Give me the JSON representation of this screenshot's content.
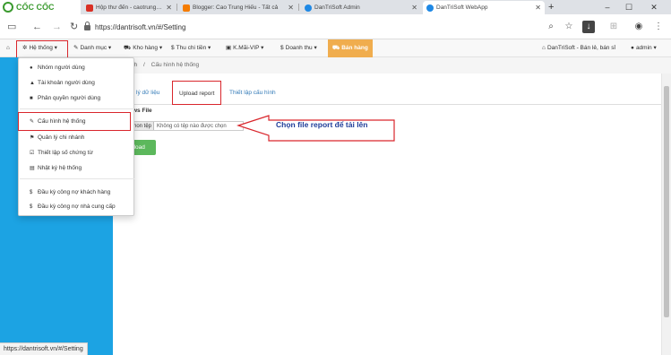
{
  "browser": {
    "logo_text": "CỐC CỐC",
    "tabs": [
      {
        "title": "Hộp thư đến - caotrunghieu.com",
        "favicon_color": "#d93025"
      },
      {
        "title": "Blogger: Cao Trung Hiếu - Tất cả",
        "favicon_color": "#f57c00"
      },
      {
        "title": "DanTriSoft Admin",
        "favicon_color": "#1e88e5"
      },
      {
        "title": "DanTriSoft WebApp",
        "favicon_color": "#1e88e5"
      }
    ],
    "active_tab": 3,
    "new_tab_label": "+",
    "url": "https://dantrisoft.vn/#/Setting",
    "status_url": "https://dantrisoft.vn/#/Setting"
  },
  "navbar": {
    "items": [
      {
        "label": "Hệ thống",
        "icon": "gear-icon"
      },
      {
        "label": "Danh mục",
        "icon": "pencil-icon"
      },
      {
        "label": "Kho hàng",
        "icon": "cart-icon"
      },
      {
        "label": "Thu chi tiền",
        "icon": "dollar-icon"
      },
      {
        "label": "K.Mãi-VIP",
        "icon": "ticket-icon"
      },
      {
        "label": "Doanh thu",
        "icon": "dollar-icon"
      }
    ],
    "sell_button": "Bán hàng",
    "company": "DanTriSoft - Bán lẻ, bán sỉ",
    "user": "admin"
  },
  "breadcrumb": {
    "part1": "nh",
    "sep": "/",
    "part2": "Cấu hình hệ thống"
  },
  "content_tabs": [
    "nh lý dữ liệu",
    "Upload report",
    "Thiết lập cấu hình"
  ],
  "active_content_tab": 1,
  "form": {
    "label": "ws File",
    "file_button": "hon tệp",
    "file_placeholder": "Không có tệp nào được chọn",
    "upload_button": "pload"
  },
  "dropdown": {
    "items": [
      {
        "label": "Nhóm người dùng",
        "icon": "users-icon"
      },
      {
        "label": "Tài khoản người dùng",
        "icon": "user-icon"
      },
      {
        "label": "Phân quyền người dùng",
        "icon": "lock-icon"
      },
      {
        "label": "Cấu hình hệ thống",
        "icon": "wrench-icon"
      },
      {
        "label": "Quản lý chi nhánh",
        "icon": "flag-icon"
      },
      {
        "label": "Thiết lập số chứng từ",
        "icon": "edit-icon"
      },
      {
        "label": "Nhật ký hệ thống",
        "icon": "book-icon"
      },
      {
        "label": "Đầu kỳ công nợ khách hàng",
        "icon": "dollar-icon"
      },
      {
        "label": "Đầu kỳ công nợ nhà cung cấp",
        "icon": "dollar-icon"
      }
    ],
    "highlighted": 3
  },
  "annotation": {
    "text": "Chọn file report để tải lên"
  },
  "colors": {
    "sidebar": "#1ca3e3",
    "highlight_box": "#d9262c",
    "upload_button": "#5cb85c",
    "sell_button": "#f0ad4e",
    "annotation_text": "#1f3d99"
  }
}
